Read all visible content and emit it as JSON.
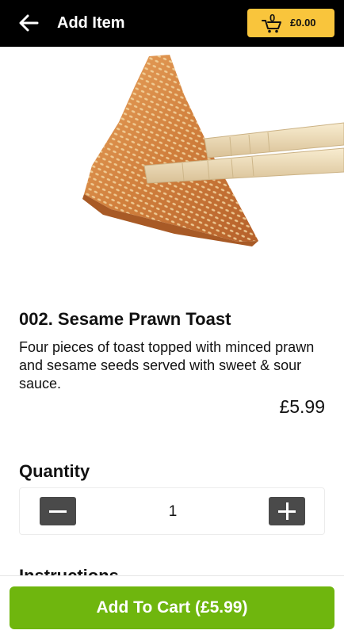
{
  "header": {
    "back_icon": "arrow-left-icon",
    "title": "Add Item",
    "cart": {
      "icon": "shopping-cart-icon",
      "count": "0",
      "total": "£0.00",
      "color": "#f9c53c"
    }
  },
  "item": {
    "image_alt": "sesame-prawn-toast-with-chopsticks",
    "name": "002. Sesame Prawn Toast",
    "description": "Four pieces of toast topped with minced prawn and sesame seeds served with sweet & sour sauce.",
    "price": "£5.99"
  },
  "quantity": {
    "label": "Quantity",
    "value": "1",
    "minus_icon": "minus-icon",
    "plus_icon": "plus-icon"
  },
  "instructions": {
    "label": "Instructions"
  },
  "footer": {
    "add_to_cart_label": "Add To Cart (£5.99)",
    "color": "#6fb60e"
  }
}
